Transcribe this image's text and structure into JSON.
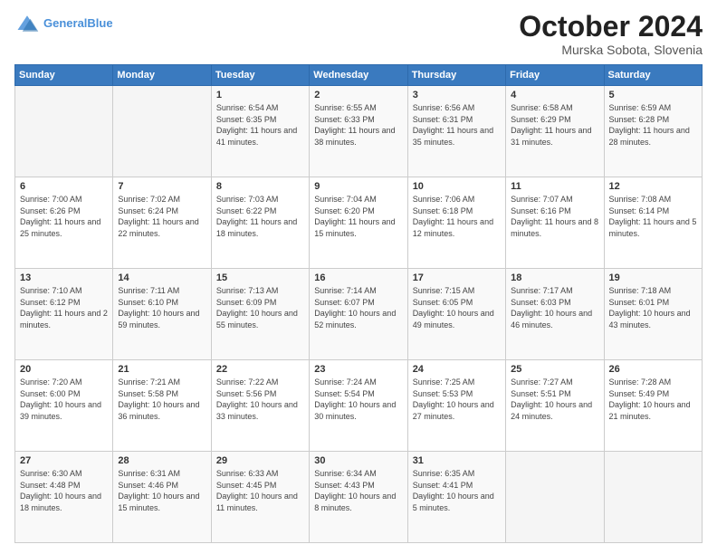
{
  "header": {
    "logo_line1": "General",
    "logo_line2": "Blue",
    "month": "October 2024",
    "location": "Murska Sobota, Slovenia"
  },
  "weekdays": [
    "Sunday",
    "Monday",
    "Tuesday",
    "Wednesday",
    "Thursday",
    "Friday",
    "Saturday"
  ],
  "weeks": [
    [
      {
        "day": "",
        "sunrise": "",
        "sunset": "",
        "daylight": ""
      },
      {
        "day": "",
        "sunrise": "",
        "sunset": "",
        "daylight": ""
      },
      {
        "day": "1",
        "sunrise": "Sunrise: 6:54 AM",
        "sunset": "Sunset: 6:35 PM",
        "daylight": "Daylight: 11 hours and 41 minutes."
      },
      {
        "day": "2",
        "sunrise": "Sunrise: 6:55 AM",
        "sunset": "Sunset: 6:33 PM",
        "daylight": "Daylight: 11 hours and 38 minutes."
      },
      {
        "day": "3",
        "sunrise": "Sunrise: 6:56 AM",
        "sunset": "Sunset: 6:31 PM",
        "daylight": "Daylight: 11 hours and 35 minutes."
      },
      {
        "day": "4",
        "sunrise": "Sunrise: 6:58 AM",
        "sunset": "Sunset: 6:29 PM",
        "daylight": "Daylight: 11 hours and 31 minutes."
      },
      {
        "day": "5",
        "sunrise": "Sunrise: 6:59 AM",
        "sunset": "Sunset: 6:28 PM",
        "daylight": "Daylight: 11 hours and 28 minutes."
      }
    ],
    [
      {
        "day": "6",
        "sunrise": "Sunrise: 7:00 AM",
        "sunset": "Sunset: 6:26 PM",
        "daylight": "Daylight: 11 hours and 25 minutes."
      },
      {
        "day": "7",
        "sunrise": "Sunrise: 7:02 AM",
        "sunset": "Sunset: 6:24 PM",
        "daylight": "Daylight: 11 hours and 22 minutes."
      },
      {
        "day": "8",
        "sunrise": "Sunrise: 7:03 AM",
        "sunset": "Sunset: 6:22 PM",
        "daylight": "Daylight: 11 hours and 18 minutes."
      },
      {
        "day": "9",
        "sunrise": "Sunrise: 7:04 AM",
        "sunset": "Sunset: 6:20 PM",
        "daylight": "Daylight: 11 hours and 15 minutes."
      },
      {
        "day": "10",
        "sunrise": "Sunrise: 7:06 AM",
        "sunset": "Sunset: 6:18 PM",
        "daylight": "Daylight: 11 hours and 12 minutes."
      },
      {
        "day": "11",
        "sunrise": "Sunrise: 7:07 AM",
        "sunset": "Sunset: 6:16 PM",
        "daylight": "Daylight: 11 hours and 8 minutes."
      },
      {
        "day": "12",
        "sunrise": "Sunrise: 7:08 AM",
        "sunset": "Sunset: 6:14 PM",
        "daylight": "Daylight: 11 hours and 5 minutes."
      }
    ],
    [
      {
        "day": "13",
        "sunrise": "Sunrise: 7:10 AM",
        "sunset": "Sunset: 6:12 PM",
        "daylight": "Daylight: 11 hours and 2 minutes."
      },
      {
        "day": "14",
        "sunrise": "Sunrise: 7:11 AM",
        "sunset": "Sunset: 6:10 PM",
        "daylight": "Daylight: 10 hours and 59 minutes."
      },
      {
        "day": "15",
        "sunrise": "Sunrise: 7:13 AM",
        "sunset": "Sunset: 6:09 PM",
        "daylight": "Daylight: 10 hours and 55 minutes."
      },
      {
        "day": "16",
        "sunrise": "Sunrise: 7:14 AM",
        "sunset": "Sunset: 6:07 PM",
        "daylight": "Daylight: 10 hours and 52 minutes."
      },
      {
        "day": "17",
        "sunrise": "Sunrise: 7:15 AM",
        "sunset": "Sunset: 6:05 PM",
        "daylight": "Daylight: 10 hours and 49 minutes."
      },
      {
        "day": "18",
        "sunrise": "Sunrise: 7:17 AM",
        "sunset": "Sunset: 6:03 PM",
        "daylight": "Daylight: 10 hours and 46 minutes."
      },
      {
        "day": "19",
        "sunrise": "Sunrise: 7:18 AM",
        "sunset": "Sunset: 6:01 PM",
        "daylight": "Daylight: 10 hours and 43 minutes."
      }
    ],
    [
      {
        "day": "20",
        "sunrise": "Sunrise: 7:20 AM",
        "sunset": "Sunset: 6:00 PM",
        "daylight": "Daylight: 10 hours and 39 minutes."
      },
      {
        "day": "21",
        "sunrise": "Sunrise: 7:21 AM",
        "sunset": "Sunset: 5:58 PM",
        "daylight": "Daylight: 10 hours and 36 minutes."
      },
      {
        "day": "22",
        "sunrise": "Sunrise: 7:22 AM",
        "sunset": "Sunset: 5:56 PM",
        "daylight": "Daylight: 10 hours and 33 minutes."
      },
      {
        "day": "23",
        "sunrise": "Sunrise: 7:24 AM",
        "sunset": "Sunset: 5:54 PM",
        "daylight": "Daylight: 10 hours and 30 minutes."
      },
      {
        "day": "24",
        "sunrise": "Sunrise: 7:25 AM",
        "sunset": "Sunset: 5:53 PM",
        "daylight": "Daylight: 10 hours and 27 minutes."
      },
      {
        "day": "25",
        "sunrise": "Sunrise: 7:27 AM",
        "sunset": "Sunset: 5:51 PM",
        "daylight": "Daylight: 10 hours and 24 minutes."
      },
      {
        "day": "26",
        "sunrise": "Sunrise: 7:28 AM",
        "sunset": "Sunset: 5:49 PM",
        "daylight": "Daylight: 10 hours and 21 minutes."
      }
    ],
    [
      {
        "day": "27",
        "sunrise": "Sunrise: 6:30 AM",
        "sunset": "Sunset: 4:48 PM",
        "daylight": "Daylight: 10 hours and 18 minutes."
      },
      {
        "day": "28",
        "sunrise": "Sunrise: 6:31 AM",
        "sunset": "Sunset: 4:46 PM",
        "daylight": "Daylight: 10 hours and 15 minutes."
      },
      {
        "day": "29",
        "sunrise": "Sunrise: 6:33 AM",
        "sunset": "Sunset: 4:45 PM",
        "daylight": "Daylight: 10 hours and 11 minutes."
      },
      {
        "day": "30",
        "sunrise": "Sunrise: 6:34 AM",
        "sunset": "Sunset: 4:43 PM",
        "daylight": "Daylight: 10 hours and 8 minutes."
      },
      {
        "day": "31",
        "sunrise": "Sunrise: 6:35 AM",
        "sunset": "Sunset: 4:41 PM",
        "daylight": "Daylight: 10 hours and 5 minutes."
      },
      {
        "day": "",
        "sunrise": "",
        "sunset": "",
        "daylight": ""
      },
      {
        "day": "",
        "sunrise": "",
        "sunset": "",
        "daylight": ""
      }
    ]
  ]
}
